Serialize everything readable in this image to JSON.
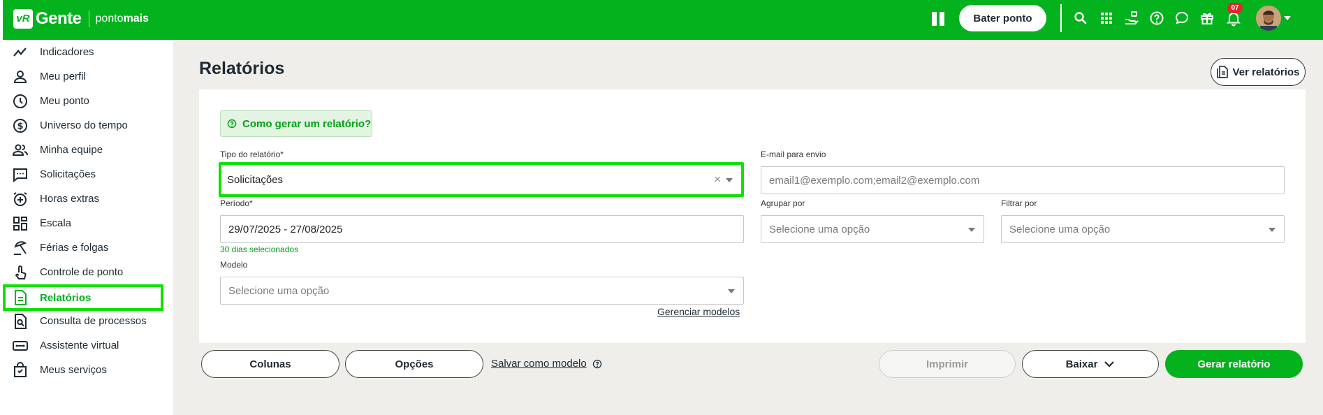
{
  "brand": {
    "badge": "vR",
    "name": "Gente",
    "product_prefix": "ponto",
    "product_suffix": "mais"
  },
  "topbar": {
    "bater_ponto_label": "Bater ponto",
    "notifications_count": "07",
    "icons": [
      "pause-icon",
      "search-icon",
      "apps-grid-icon",
      "benefits-hand-icon",
      "help-icon",
      "chat-icon",
      "gift-icon",
      "bell-icon",
      "avatar"
    ]
  },
  "sidebar": {
    "items": [
      {
        "label": "Indicadores",
        "icon": "chart-line-icon"
      },
      {
        "label": "Meu perfil",
        "icon": "user-icon"
      },
      {
        "label": "Meu ponto",
        "icon": "clock-icon"
      },
      {
        "label": "Universo do tempo",
        "icon": "dollar-circle-icon"
      },
      {
        "label": "Minha equipe",
        "icon": "team-icon"
      },
      {
        "label": "Solicitações",
        "icon": "message-icon"
      },
      {
        "label": "Horas extras",
        "icon": "alarm-plus-icon"
      },
      {
        "label": "Escala",
        "icon": "grid-icon"
      },
      {
        "label": "Férias e folgas",
        "icon": "beach-umbrella-icon"
      },
      {
        "label": "Controle de ponto",
        "icon": "touch-icon"
      },
      {
        "label": "Relatórios",
        "icon": "document-icon",
        "active": true
      },
      {
        "label": "Consulta de processos",
        "icon": "document-search-icon"
      },
      {
        "label": "Assistente virtual",
        "icon": "assistant-icon"
      },
      {
        "label": "Meus serviços",
        "icon": "bag-icon"
      }
    ]
  },
  "page": {
    "title": "Relatórios",
    "ver_relatorios_label": "Ver relatórios",
    "help_label": "Como gerar um relatório?"
  },
  "form": {
    "tipo_label": "Tipo do relatório*",
    "tipo_value": "Solicitações",
    "email_label": "E-mail para envio",
    "email_placeholder": "email1@exemplo.com;email2@exemplo.com",
    "periodo_label": "Período*",
    "periodo_value": "29/07/2025 - 27/08/2025",
    "periodo_hint": "30 dias selecionados",
    "agrupar_label": "Agrupar por",
    "agrupar_placeholder": "Selecione uma opção",
    "filtrar_label": "Filtrar por",
    "filtrar_placeholder": "Selecione uma opção",
    "modelo_label": "Modelo",
    "modelo_placeholder": "Selecione uma opção",
    "gerenciar_label": "Gerenciar modelos"
  },
  "actions": {
    "colunas": "Colunas",
    "opcoes": "Opções",
    "salvar_modelo": "Salvar como modelo",
    "imprimir": "Imprimir",
    "baixar": "Baixar",
    "gerar": "Gerar relatório"
  },
  "colors": {
    "brand_green": "#03b21d",
    "highlight": "#12e000",
    "badge_red": "#e0262d",
    "background": "#efeeea"
  }
}
